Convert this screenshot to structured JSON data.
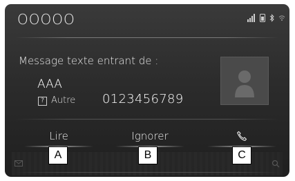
{
  "header": {
    "title": "OOOOO"
  },
  "message": {
    "heading": "Message texte entrant de :",
    "sender": "AAA",
    "type_label": "Autre",
    "type_icon": "?",
    "number": "0123456789"
  },
  "actions": {
    "read_label": "Lire",
    "ignore_label": "Ignorer"
  },
  "callouts": [
    "A",
    "B",
    "C"
  ],
  "icons": {
    "status": [
      "signal-icon",
      "phone-battery-icon",
      "bluetooth-icon",
      "wifi-icon"
    ],
    "call": "phone-handset-icon",
    "avatar": "contact-silhouette-icon"
  }
}
